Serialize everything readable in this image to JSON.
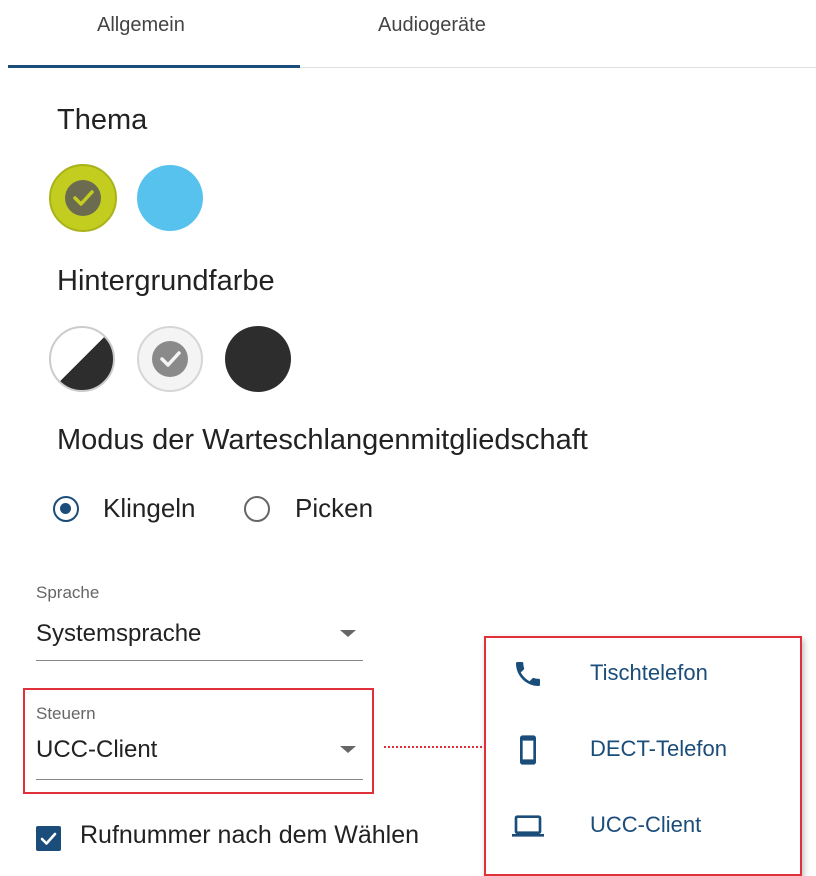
{
  "tabs": [
    {
      "label": "Allgemein",
      "active": true
    },
    {
      "label": "Audiogeräte",
      "active": false
    }
  ],
  "theme": {
    "title": "Thema",
    "swatches": [
      {
        "color": "#c3cd1f",
        "selected": true
      },
      {
        "color": "#57c2ee",
        "selected": false
      }
    ]
  },
  "background": {
    "title": "Hintergrundfarbe",
    "swatches": [
      {
        "color": "half-white-half-dark",
        "selected": false
      },
      {
        "color": "#f4f4f4",
        "selected": true
      },
      {
        "color": "#2d2d2d",
        "selected": false
      }
    ]
  },
  "queue_mode": {
    "title": "Modus der Warteschlangenmitgliedschaft",
    "options": [
      {
        "label": "Klingeln",
        "checked": true
      },
      {
        "label": "Picken",
        "checked": false
      }
    ]
  },
  "language": {
    "label": "Sprache",
    "value": "Systemsprache"
  },
  "control": {
    "label": "Steuern",
    "value": "UCC-Client",
    "menu": [
      {
        "label": "Tischtelefon",
        "icon": "phone-icon"
      },
      {
        "label": "DECT-Telefon",
        "icon": "mobile-phone-icon"
      },
      {
        "label": "UCC-Client",
        "icon": "laptop-icon"
      }
    ]
  },
  "dial_option": {
    "label": "Rufnummer nach dem Wählen",
    "checked": true
  },
  "colors": {
    "accent": "#1b4d7a",
    "highlight": "#e0303a"
  }
}
